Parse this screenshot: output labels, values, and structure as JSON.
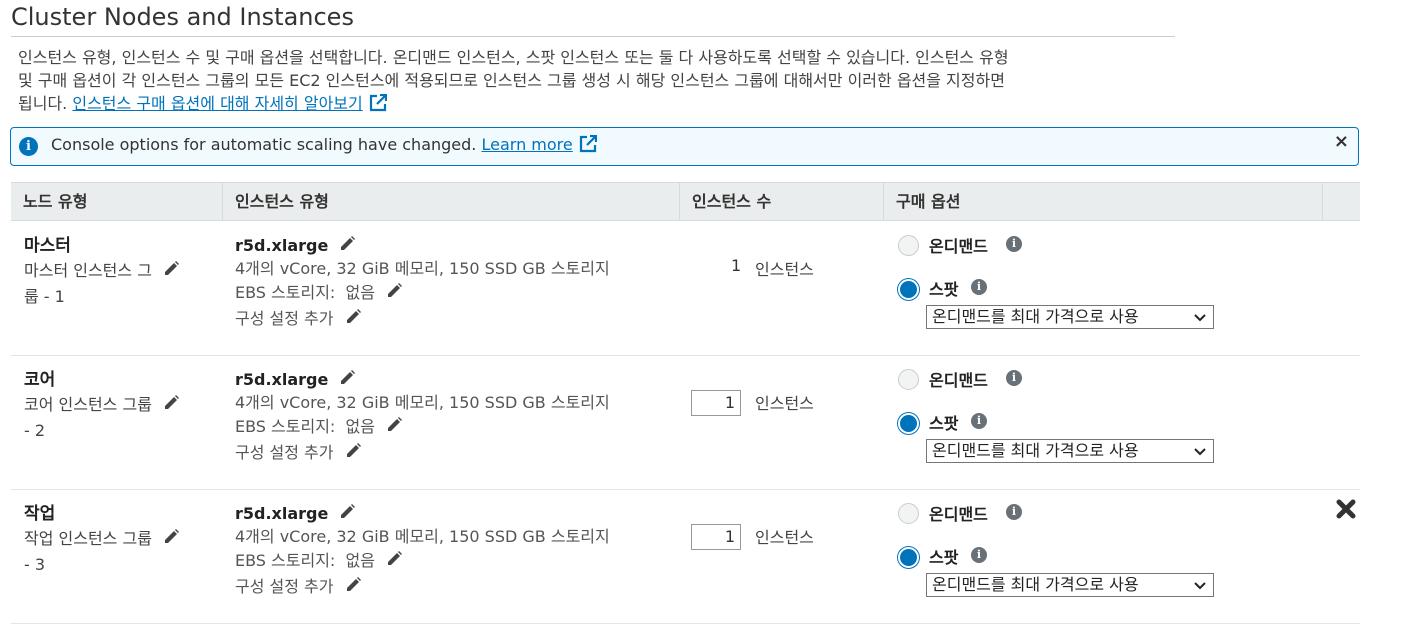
{
  "section": {
    "title": "Cluster Nodes and Instances",
    "description_line1": "인스턴스 유형, 인스턴스 수 및 구매 옵션을 선택합니다. 온디맨드 인스턴스, 스팟 인스턴스 또는 둘 다 사용하도록 선택할 수 있습니다. 인스턴스 유형",
    "description_line2": "및 구매 옵션이 각 인스턴스 그룹의 모든 EC2 인스턴스에 적용되므로 인스턴스 그룹 생성 시 해당 인스턴스 그룹에 대해서만 이러한 옵션을 지정하면",
    "description_line3": "됩니다.",
    "learn_link": "인스턴스 구매 옵션에 대해 자세히 알아보기"
  },
  "banner": {
    "message": "Console options for automatic scaling have changed.",
    "link": "Learn more",
    "close": "×"
  },
  "table": {
    "headers": [
      "노드 유형",
      "인스턴스 유형",
      "인스턴스 수",
      "구매 옵션"
    ],
    "rows": [
      {
        "node_type": "마스터",
        "group_line1": "마스터 인스턴스 그",
        "group_line2": "룹 - 1",
        "instance_type": "r5d.xlarge",
        "spec": "4개의 vCore, 32 GiB 메모리, 150 SSD GB 스토리지",
        "ebs_label": "EBS 스토리지:",
        "ebs_value": "없음",
        "config": "구성 설정 추가",
        "count": "1",
        "count_unit": "인스턴스",
        "on_demand": "온디맨드",
        "spot": "스팟",
        "price_option": "온디맨드를 최대 가격으로 사용"
      },
      {
        "node_type": "코어",
        "group_line1": "코어 인스턴스 그룹",
        "group_line2": "- 2",
        "instance_type": "r5d.xlarge",
        "spec": "4개의 vCore, 32 GiB 메모리, 150 SSD GB 스토리지",
        "ebs_label": "EBS 스토리지:",
        "ebs_value": "없음",
        "config": "구성 설정 추가",
        "count": "1",
        "count_unit": "인스턴스",
        "on_demand": "온디맨드",
        "spot": "스팟",
        "price_option": "온디맨드를 최대 가격으로 사용"
      },
      {
        "node_type": "작업",
        "group_line1": "작업 인스턴스 그룹",
        "group_line2": "- 3",
        "instance_type": "r5d.xlarge",
        "spec": "4개의 vCore, 32 GiB 메모리, 150 SSD GB 스토리지",
        "ebs_label": "EBS 스토리지:",
        "ebs_value": "없음",
        "config": "구성 설정 추가",
        "count": "1",
        "count_unit": "인스턴스",
        "on_demand": "온디맨드",
        "spot": "스팟",
        "price_option": "온디맨드를 최대 가격으로 사용"
      }
    ]
  }
}
